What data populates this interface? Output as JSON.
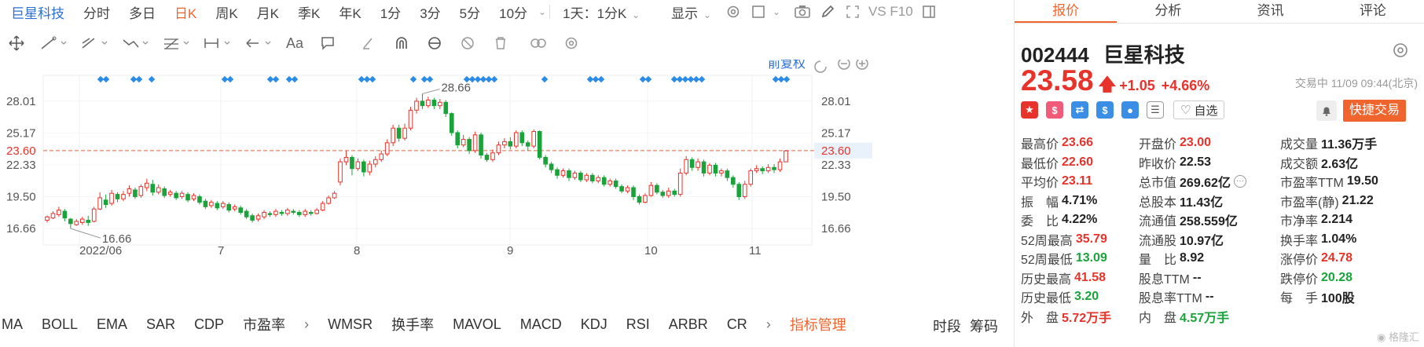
{
  "topbar": {
    "stock_name": "巨星科技",
    "periods": [
      "分时",
      "多日",
      "日K",
      "周K",
      "月K",
      "季K",
      "年K",
      "1分",
      "3分",
      "5分",
      "10分"
    ],
    "active_period": "日K",
    "range_select": "1天：1分K",
    "display_label": "显示",
    "vs_label": "VS F10"
  },
  "chart_header": {
    "adjust_label": "前复权"
  },
  "chart_data": {
    "type": "candlestick",
    "left_ticks": [
      "28.01",
      "25.17",
      "23.60",
      "22.33",
      "19.50",
      "16.66"
    ],
    "right_ticks": [
      "28.01",
      "25.17",
      "23.60",
      "22.33",
      "19.50",
      "16.66"
    ],
    "x_ticks": [
      "2022/06",
      "7",
      "8",
      "9",
      "10",
      "11"
    ],
    "max_label": "28.66",
    "min_label": "16.66",
    "last_close_line": "23.60",
    "ylim": [
      15.2,
      30.3
    ],
    "candles": [
      [
        17.4,
        17.7,
        17.2,
        17.8
      ],
      [
        17.6,
        18.0,
        17.5,
        18.2
      ],
      [
        17.9,
        18.3,
        17.7,
        18.6
      ],
      [
        18.2,
        17.6,
        17.3,
        18.4
      ],
      [
        17.5,
        17.1,
        16.66,
        17.6
      ],
      [
        17.0,
        17.3,
        16.9,
        17.5
      ],
      [
        17.2,
        17.5,
        17.0,
        17.7
      ],
      [
        17.4,
        17.2,
        16.9,
        17.8
      ],
      [
        17.3,
        18.4,
        17.2,
        18.6
      ],
      [
        18.4,
        19.4,
        18.3,
        19.9
      ],
      [
        19.2,
        18.8,
        18.5,
        19.7
      ],
      [
        18.9,
        19.8,
        18.7,
        20.1
      ],
      [
        19.7,
        19.3,
        19.0,
        19.9
      ],
      [
        19.3,
        19.7,
        19.1,
        20.0
      ],
      [
        19.8,
        20.2,
        19.5,
        20.5
      ],
      [
        20.1,
        19.5,
        19.3,
        20.3
      ],
      [
        19.6,
        20.4,
        19.4,
        20.6
      ],
      [
        20.3,
        20.7,
        20.0,
        21.1
      ],
      [
        20.6,
        19.9,
        19.6,
        21.0
      ],
      [
        19.9,
        20.3,
        19.7,
        20.6
      ],
      [
        20.2,
        19.6,
        19.4,
        20.4
      ],
      [
        19.7,
        19.9,
        19.5,
        20.1
      ],
      [
        19.8,
        19.4,
        19.2,
        20.0
      ],
      [
        19.5,
        19.8,
        19.3,
        20.0
      ],
      [
        19.7,
        19.2,
        19.0,
        19.9
      ],
      [
        19.3,
        19.6,
        19.1,
        19.8
      ],
      [
        19.5,
        19.0,
        18.8,
        19.7
      ],
      [
        19.1,
        18.6,
        18.4,
        19.3
      ],
      [
        18.7,
        19.0,
        18.5,
        19.2
      ],
      [
        18.9,
        18.5,
        18.3,
        19.1
      ],
      [
        18.6,
        18.9,
        18.4,
        19.1
      ],
      [
        18.8,
        18.3,
        18.1,
        19.0
      ],
      [
        18.4,
        18.6,
        18.2,
        18.8
      ],
      [
        18.5,
        18.1,
        17.9,
        18.7
      ],
      [
        18.2,
        17.7,
        17.5,
        18.4
      ],
      [
        17.8,
        17.4,
        17.2,
        18.0
      ],
      [
        17.5,
        17.8,
        17.3,
        18.0
      ],
      [
        17.7,
        18.1,
        17.5,
        18.3
      ],
      [
        18.0,
        17.9,
        17.7,
        18.2
      ],
      [
        17.9,
        18.2,
        17.7,
        18.4
      ],
      [
        18.1,
        18.0,
        17.8,
        18.3
      ],
      [
        18.0,
        18.3,
        17.8,
        18.5
      ],
      [
        18.2,
        18.1,
        17.9,
        18.4
      ],
      [
        18.1,
        17.9,
        17.7,
        18.3
      ],
      [
        17.9,
        18.2,
        17.7,
        18.4
      ],
      [
        18.1,
        18.0,
        17.8,
        18.3
      ],
      [
        18.0,
        18.3,
        17.9,
        18.5
      ],
      [
        18.3,
        18.9,
        18.2,
        19.1
      ],
      [
        18.9,
        19.4,
        18.8,
        19.6
      ],
      [
        19.4,
        19.8,
        19.3,
        20.0
      ],
      [
        20.8,
        22.6,
        20.5,
        22.9
      ],
      [
        22.6,
        23.0,
        22.3,
        23.6
      ],
      [
        23.0,
        22.0,
        21.4,
        23.2
      ],
      [
        22.0,
        22.6,
        21.8,
        22.9
      ],
      [
        22.6,
        21.7,
        21.3,
        22.8
      ],
      [
        21.7,
        22.4,
        21.4,
        22.7
      ],
      [
        22.4,
        22.8,
        22.1,
        23.1
      ],
      [
        22.8,
        23.3,
        22.6,
        23.6
      ],
      [
        23.3,
        24.3,
        23.1,
        24.6
      ],
      [
        24.3,
        25.6,
        24.0,
        25.9
      ],
      [
        25.6,
        24.7,
        24.4,
        25.9
      ],
      [
        24.7,
        25.6,
        24.5,
        26.0
      ],
      [
        25.6,
        27.2,
        25.4,
        27.5
      ],
      [
        27.2,
        28.0,
        26.9,
        28.3
      ],
      [
        28.0,
        27.6,
        27.3,
        28.66
      ],
      [
        27.6,
        28.1,
        27.4,
        28.4
      ],
      [
        28.1,
        27.6,
        27.3,
        28.3
      ],
      [
        27.6,
        27.9,
        27.3,
        28.2
      ],
      [
        27.9,
        26.9,
        26.6,
        28.1
      ],
      [
        26.9,
        25.2,
        24.9,
        27.0
      ],
      [
        25.2,
        24.1,
        23.8,
        25.4
      ],
      [
        24.1,
        24.6,
        23.9,
        25.0
      ],
      [
        24.6,
        23.6,
        23.3,
        24.8
      ],
      [
        23.6,
        25.0,
        23.4,
        25.3
      ],
      [
        25.0,
        23.2,
        22.9,
        25.2
      ],
      [
        23.2,
        22.8,
        22.6,
        23.4
      ],
      [
        22.8,
        23.4,
        22.6,
        23.7
      ],
      [
        23.4,
        24.1,
        23.2,
        24.4
      ],
      [
        24.1,
        24.4,
        23.8,
        24.7
      ],
      [
        24.4,
        24.0,
        23.7,
        24.8
      ],
      [
        24.0,
        25.2,
        23.8,
        25.4
      ],
      [
        25.2,
        24.3,
        24.0,
        25.4
      ],
      [
        24.3,
        24.0,
        23.6,
        24.5
      ],
      [
        24.0,
        25.3,
        23.8,
        25.5
      ],
      [
        25.3,
        23.0,
        22.8,
        25.4
      ],
      [
        23.0,
        22.4,
        22.1,
        23.2
      ],
      [
        22.4,
        21.9,
        21.6,
        22.6
      ],
      [
        21.9,
        21.4,
        21.1,
        22.1
      ],
      [
        21.4,
        21.8,
        21.2,
        22.0
      ],
      [
        21.8,
        21.2,
        20.9,
        22.0
      ],
      [
        21.2,
        21.6,
        21.0,
        21.8
      ],
      [
        21.6,
        21.0,
        20.8,
        21.8
      ],
      [
        21.0,
        21.4,
        20.8,
        21.6
      ],
      [
        21.4,
        20.9,
        20.7,
        21.6
      ],
      [
        20.9,
        21.2,
        20.7,
        21.4
      ],
      [
        21.2,
        20.6,
        20.4,
        21.4
      ],
      [
        20.6,
        20.9,
        20.4,
        21.1
      ],
      [
        20.9,
        20.4,
        20.2,
        21.1
      ],
      [
        20.4,
        20.0,
        19.8,
        20.6
      ],
      [
        20.0,
        20.3,
        19.8,
        20.5
      ],
      [
        20.3,
        19.5,
        19.2,
        20.5
      ],
      [
        19.5,
        19.0,
        18.8,
        19.7
      ],
      [
        19.0,
        19.6,
        18.9,
        19.8
      ],
      [
        19.6,
        20.5,
        19.5,
        20.8
      ],
      [
        20.5,
        19.9,
        19.7,
        20.7
      ],
      [
        19.9,
        19.6,
        19.4,
        20.1
      ],
      [
        19.6,
        20.0,
        19.4,
        20.3
      ],
      [
        20.0,
        19.7,
        19.5,
        20.2
      ],
      [
        19.7,
        21.6,
        19.5,
        22.0
      ],
      [
        21.6,
        22.8,
        21.4,
        23.1
      ],
      [
        22.8,
        22.1,
        21.8,
        23.0
      ],
      [
        22.1,
        22.6,
        21.8,
        22.9
      ],
      [
        22.6,
        21.6,
        21.3,
        22.8
      ],
      [
        21.6,
        22.3,
        21.4,
        22.5
      ],
      [
        22.3,
        21.6,
        21.3,
        22.5
      ],
      [
        21.6,
        21.8,
        21.3,
        22.0
      ],
      [
        21.8,
        21.2,
        20.9,
        22.0
      ],
      [
        21.2,
        20.6,
        20.3,
        21.4
      ],
      [
        20.6,
        19.5,
        19.2,
        20.8
      ],
      [
        19.5,
        20.6,
        19.3,
        20.9
      ],
      [
        20.6,
        21.8,
        20.4,
        22.0
      ],
      [
        21.8,
        22.0,
        21.6,
        22.3
      ],
      [
        22.0,
        21.8,
        21.5,
        22.2
      ],
      [
        21.8,
        22.1,
        21.6,
        22.4
      ],
      [
        22.1,
        21.9,
        21.6,
        22.4
      ],
      [
        21.9,
        22.6,
        21.7,
        22.9
      ],
      [
        22.6,
        23.58,
        22.6,
        23.66
      ]
    ]
  },
  "indicators": {
    "items": [
      "MA",
      "BOLL",
      "EMA",
      "SAR",
      "CDP",
      "市盈率"
    ],
    "items2": [
      "WMSR",
      "换手率",
      "MAVOL",
      "MACD",
      "KDJ",
      "RSI",
      "ARBR",
      "CR"
    ],
    "manager": "指标管理",
    "right1": "时段",
    "right2": "筹码"
  },
  "panel": {
    "tabs": [
      "报价",
      "分析",
      "资讯",
      "评论"
    ],
    "active_tab": "报价",
    "code": "002444",
    "name": "巨星科技",
    "price": "23.58",
    "change": "+1.05",
    "change_pct": "+4.66%",
    "status": "交易中 11/09 09:44(北京)",
    "watch_label": "自选",
    "quick_trade": "快捷交易",
    "stats": [
      [
        {
          "l": "最高价",
          "v": "23.66",
          "c": "red"
        },
        {
          "l": "开盘价",
          "v": "23.00",
          "c": "red"
        },
        {
          "l": "成交量",
          "v": "11.36万手",
          "c": "dark"
        }
      ],
      [
        {
          "l": "最低价",
          "v": "22.60",
          "c": "red"
        },
        {
          "l": "昨收价",
          "v": "22.53",
          "c": "dark"
        },
        {
          "l": "成交额",
          "v": "2.63亿",
          "c": "dark"
        }
      ],
      [
        {
          "l": "平均价",
          "v": "23.11",
          "c": "red"
        },
        {
          "l": "总市值",
          "v": "269.62亿",
          "c": "dark",
          "more": true
        },
        {
          "l": "市盈率TTM",
          "v": "19.50",
          "c": "dark"
        }
      ],
      [
        {
          "l": "振　幅",
          "v": "4.71%",
          "c": "dark"
        },
        {
          "l": "总股本",
          "v": "11.43亿",
          "c": "dark"
        },
        {
          "l": "市盈率(静)",
          "v": "21.22",
          "c": "dark"
        }
      ],
      [
        {
          "l": "委　比",
          "v": "4.22%",
          "c": "dark"
        },
        {
          "l": "流通值",
          "v": "258.559亿",
          "c": "dark"
        },
        {
          "l": "市净率",
          "v": "2.214",
          "c": "dark"
        }
      ],
      [
        {
          "l": "52周最高",
          "v": "35.79",
          "c": "red"
        },
        {
          "l": "流通股",
          "v": "10.97亿",
          "c": "dark"
        },
        {
          "l": "换手率",
          "v": "1.04%",
          "c": "dark"
        }
      ],
      [
        {
          "l": "52周最低",
          "v": "13.09",
          "c": "green"
        },
        {
          "l": "量　比",
          "v": "8.92",
          "c": "dark"
        },
        {
          "l": "涨停价",
          "v": "24.78",
          "c": "red"
        }
      ],
      [
        {
          "l": "历史最高",
          "v": "41.58",
          "c": "red"
        },
        {
          "l": "股息TTM",
          "v": "--",
          "c": "dark"
        },
        {
          "l": "跌停价",
          "v": "20.28",
          "c": "green"
        }
      ],
      [
        {
          "l": "历史最低",
          "v": "3.20",
          "c": "green"
        },
        {
          "l": "股息率TTM",
          "v": "--",
          "c": "dark"
        },
        {
          "l": "每　手",
          "v": "100股",
          "c": "dark"
        }
      ],
      [
        {
          "l": "外　盘",
          "v": "5.72万手",
          "c": "red"
        },
        {
          "l": "内　盘",
          "v": "4.57万手",
          "c": "green"
        },
        {
          "l": "",
          "v": "",
          "c": "dark"
        }
      ]
    ]
  },
  "colors": {
    "accent": "#f0642d",
    "up": "#e8332b",
    "down": "#1aa33a",
    "marker": "#2b8ce8"
  }
}
